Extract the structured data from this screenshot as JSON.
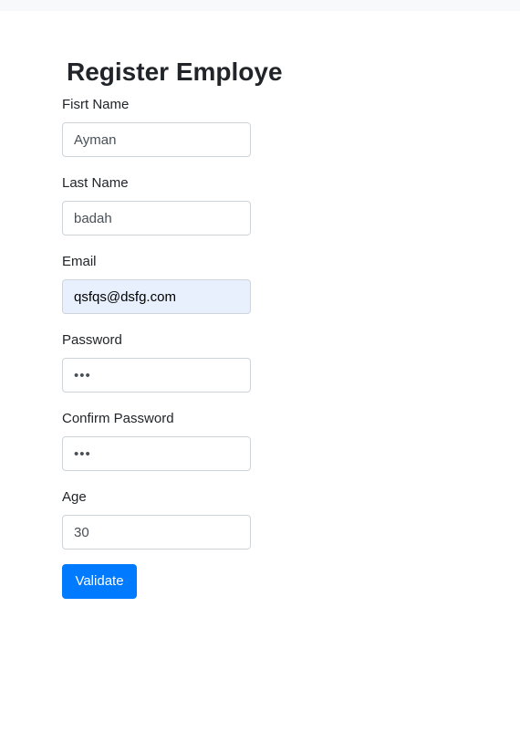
{
  "page": {
    "title": "Register Employe"
  },
  "form": {
    "fields": [
      {
        "label": "Fisrt Name",
        "value": "Ayman",
        "type": "text"
      },
      {
        "label": "Last Name",
        "value": "badah",
        "type": "text"
      },
      {
        "label": "Email",
        "value": "qsfqs@dsfg.com",
        "type": "email",
        "autofilled": true
      },
      {
        "label": "Password",
        "value": "•••",
        "type": "password"
      },
      {
        "label": "Confirm Password",
        "value": "•••",
        "type": "password"
      },
      {
        "label": "Age",
        "value": "30",
        "type": "number"
      }
    ],
    "submit_label": "Validate"
  },
  "colors": {
    "primary": "#007bff",
    "autofill_bg": "#e8f0fe",
    "input_border": "#ced4da",
    "topbar_bg": "#f8f9fa"
  }
}
